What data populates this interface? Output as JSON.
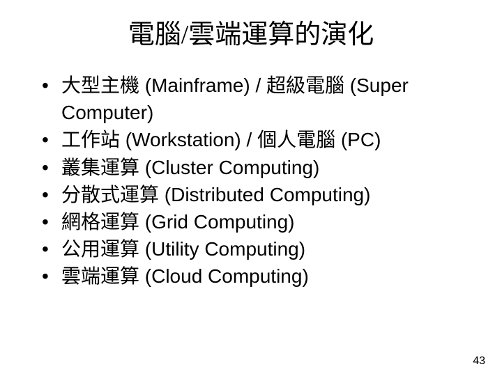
{
  "slide": {
    "title": "電腦/雲端運算的演化",
    "bullets": [
      "大型主機 (Mainframe) / 超級電腦 (Super Computer)",
      "工作站 (Workstation) / 個人電腦 (PC)",
      "叢集運算 (Cluster Computing)",
      "分散式運算 (Distributed Computing)",
      "網格運算 (Grid Computing)",
      "公用運算 (Utility Computing)",
      "雲端運算 (Cloud Computing)"
    ],
    "page_number": "43"
  }
}
